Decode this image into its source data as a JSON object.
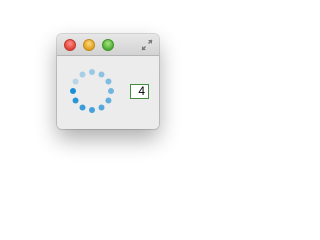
{
  "window": {
    "controls": {
      "close_color": "#ff5f57",
      "minimize_color": "#febc2e",
      "zoom_color": "#28c840",
      "fullscreen_icon": "fullscreen-arrows-icon"
    }
  },
  "spinner": {
    "icon": "loading-spinner-icon",
    "dot_count": 12,
    "accent_color": "#1a8fd6"
  },
  "counter": {
    "value": "4"
  }
}
